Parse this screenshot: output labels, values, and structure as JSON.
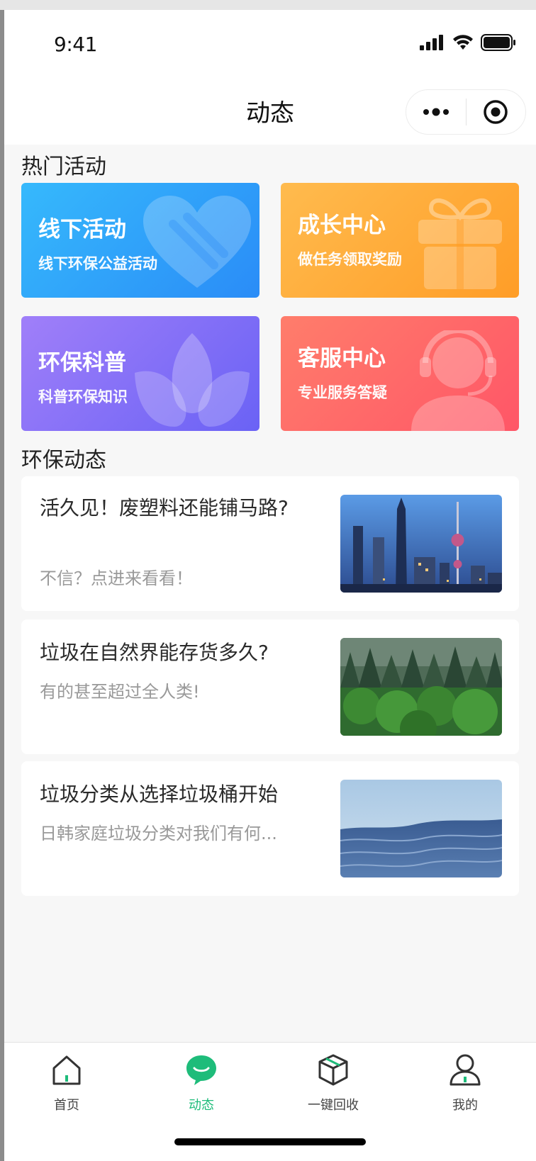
{
  "status": {
    "time": "9:41"
  },
  "nav": {
    "title": "动态"
  },
  "hot_section": {
    "title": "热门活动"
  },
  "cards": [
    {
      "title": "线下活动",
      "subtitle": "线下环保公益活动",
      "icon": "heart-icon",
      "color_from": "#34b4fb",
      "color_to": "#2d8ef8"
    },
    {
      "title": "成长中心",
      "subtitle": "做任务领取奖励",
      "icon": "gift-icon",
      "color_from": "#ffb84a",
      "color_to": "#ff9f2a"
    },
    {
      "title": "环保科普",
      "subtitle": "科普环保知识",
      "icon": "lotus-icon",
      "color_from": "#9b7cf8",
      "color_to": "#6c63f5"
    },
    {
      "title": "客服中心",
      "subtitle": "专业服务答疑",
      "icon": "headset-agent-icon",
      "color_from": "#ff7a6a",
      "color_to": "#ff5868"
    }
  ],
  "news_section": {
    "title": "环保动态"
  },
  "news": [
    {
      "title": "活久见！废塑料还能铺马路?",
      "subtitle": "不信？点进来看看！",
      "image": "city-skyline"
    },
    {
      "title": "垃圾在自然界能存货多久?",
      "subtitle": "有的甚至超过全人类!",
      "image": "forest"
    },
    {
      "title": "垃圾分类从选择垃圾桶开始",
      "subtitle": "日韩家庭垃圾分类对我们有何...",
      "image": "ocean"
    }
  ],
  "tabs": [
    {
      "label": "首页",
      "icon": "home-icon"
    },
    {
      "label": "动态",
      "icon": "chat-bubble-icon",
      "active": true
    },
    {
      "label": "一键回收",
      "icon": "box-icon"
    },
    {
      "label": "我的",
      "icon": "user-icon"
    }
  ],
  "colors": {
    "accent": "#1ebc7a"
  }
}
